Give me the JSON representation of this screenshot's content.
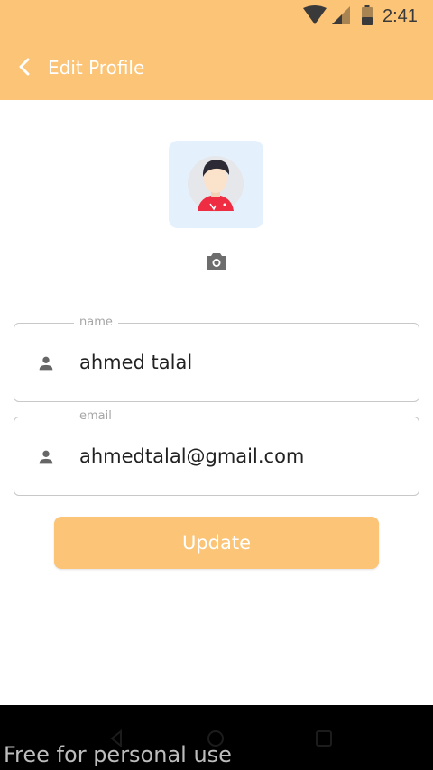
{
  "status_bar": {
    "time": "2:41",
    "icons": [
      "wifi-icon",
      "signal-icon",
      "battery-icon"
    ]
  },
  "app_bar": {
    "back_icon": "chevron-left-icon",
    "title": "Edit Profile",
    "background_color": "#fbc476"
  },
  "profile": {
    "avatar_icon": "user-avatar-icon",
    "camera_icon": "camera-icon"
  },
  "form": {
    "name": {
      "label": "name",
      "value": "ahmed talal",
      "icon": "person-icon"
    },
    "email": {
      "label": "email",
      "value": "ahmedtalal@gmail.com",
      "icon": "person-icon"
    }
  },
  "actions": {
    "update_label": "Update",
    "update_color": "#fbc476"
  },
  "nav_bar": {
    "icons": [
      "nav-back-icon",
      "nav-home-icon",
      "nav-recent-icon"
    ]
  },
  "watermark": "Free for personal use"
}
